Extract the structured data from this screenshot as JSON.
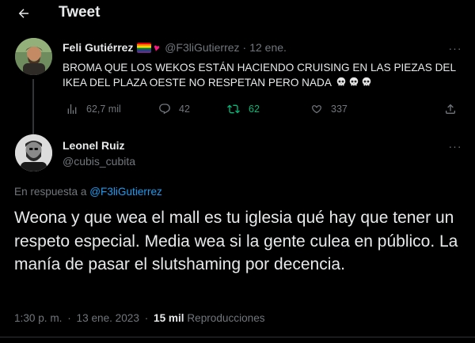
{
  "header": {
    "title": "Tweet",
    "back_icon": "arrow-left-icon"
  },
  "parent_tweet": {
    "author_name": "Feli Gutiérrez",
    "handle": "@F3liGutierrez",
    "separator": "·",
    "date": "12 ene.",
    "text": "BROMA QUE LOS WEKOS ESTÁN HACIENDO CRUISING EN LAS PIEZAS DEL IKEA DEL PLAZA OESTE NO RESPETAN PERO NADA",
    "emoji_icons": [
      "skull-icon",
      "skull-icon",
      "skull-icon"
    ],
    "actions": {
      "views": "62,7 mil",
      "replies": "42",
      "retweets": "62",
      "likes": "337"
    },
    "colors": {
      "retweet_active": "#00ba7c"
    }
  },
  "main_tweet": {
    "author_name": "Leonel Ruiz",
    "handle": "@cubis_cubita",
    "reply_prefix": "En respuesta a ",
    "reply_to": "@F3liGutierrez",
    "text": "Weona y que wea el mall es tu iglesia qué hay que tener un respeto especial. Media wea si la gente culea en público. La manía de pasar el slutshaming por decencia.",
    "time": "1:30 p. m.",
    "date_separator": "·",
    "date": "13 ene. 2023",
    "views_separator": "·",
    "views_count": "15 mil",
    "views_label": "Reproducciones"
  },
  "colors": {
    "background": "#000000",
    "text": "#e7e9ea",
    "muted": "#71767b",
    "link": "#1d9bf0"
  }
}
